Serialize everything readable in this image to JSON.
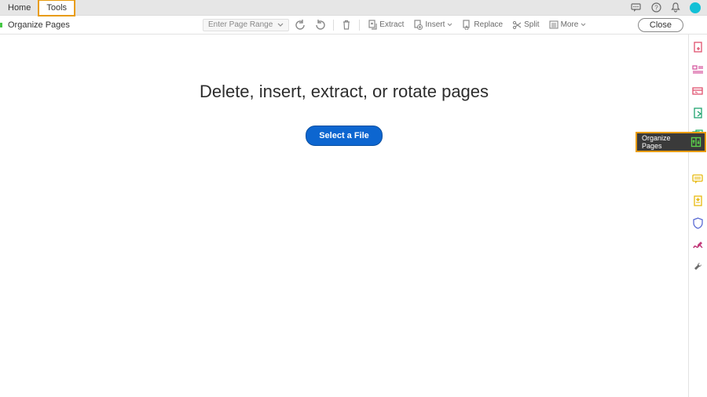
{
  "topnav": {
    "home": "Home",
    "tools": "Tools"
  },
  "subbar": {
    "title": "Organize Pages",
    "page_range_placeholder": "Enter Page Range",
    "extract": "Extract",
    "insert": "Insert",
    "replace": "Replace",
    "split": "Split",
    "more": "More",
    "close": "Close"
  },
  "main": {
    "headline": "Delete, insert, extract, or rotate pages",
    "select_label": "Select a File"
  },
  "tooltip": {
    "label": "Organize Pages"
  }
}
